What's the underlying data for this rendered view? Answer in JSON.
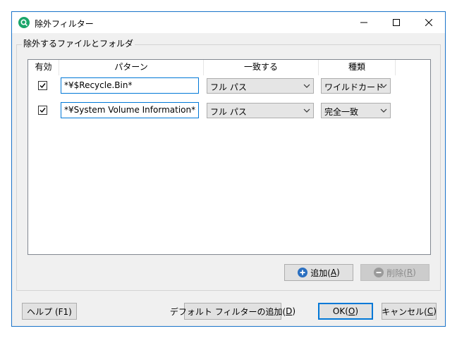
{
  "window": {
    "title": "除外フィルター",
    "controls": {
      "minimize": "—",
      "maximize": "☐",
      "close": "✕"
    }
  },
  "group": {
    "label": "除外するファイルとフォルダ"
  },
  "table": {
    "headers": {
      "enabled": "有効",
      "pattern": "パターン",
      "match": "一致する",
      "type": "種類"
    },
    "rows": [
      {
        "enabled": true,
        "pattern": "*¥$Recycle.Bin*",
        "match": "フル パス",
        "type": "ワイルドカード"
      },
      {
        "enabled": true,
        "pattern": "*¥System Volume Information*",
        "match": "フル パス",
        "type": "完全一致"
      }
    ]
  },
  "buttons": {
    "add": {
      "label": "追加(",
      "mnemonic": "A",
      "suffix": ")"
    },
    "remove": {
      "label": "削除(",
      "mnemonic": "R",
      "suffix": ")"
    },
    "help": "ヘルプ (F1)",
    "default_filter": {
      "label": "デフォルト フィルターの追加(",
      "mnemonic": "D",
      "suffix": ")"
    },
    "ok": {
      "label": "OK(",
      "mnemonic": "O",
      "suffix": ")"
    },
    "cancel": {
      "label": "キャンセル(",
      "mnemonic": "C",
      "suffix": ")"
    }
  },
  "colors": {
    "accent": "#0078d7",
    "window_border": "#1a73c9",
    "app_icon": "#1aa56a"
  }
}
